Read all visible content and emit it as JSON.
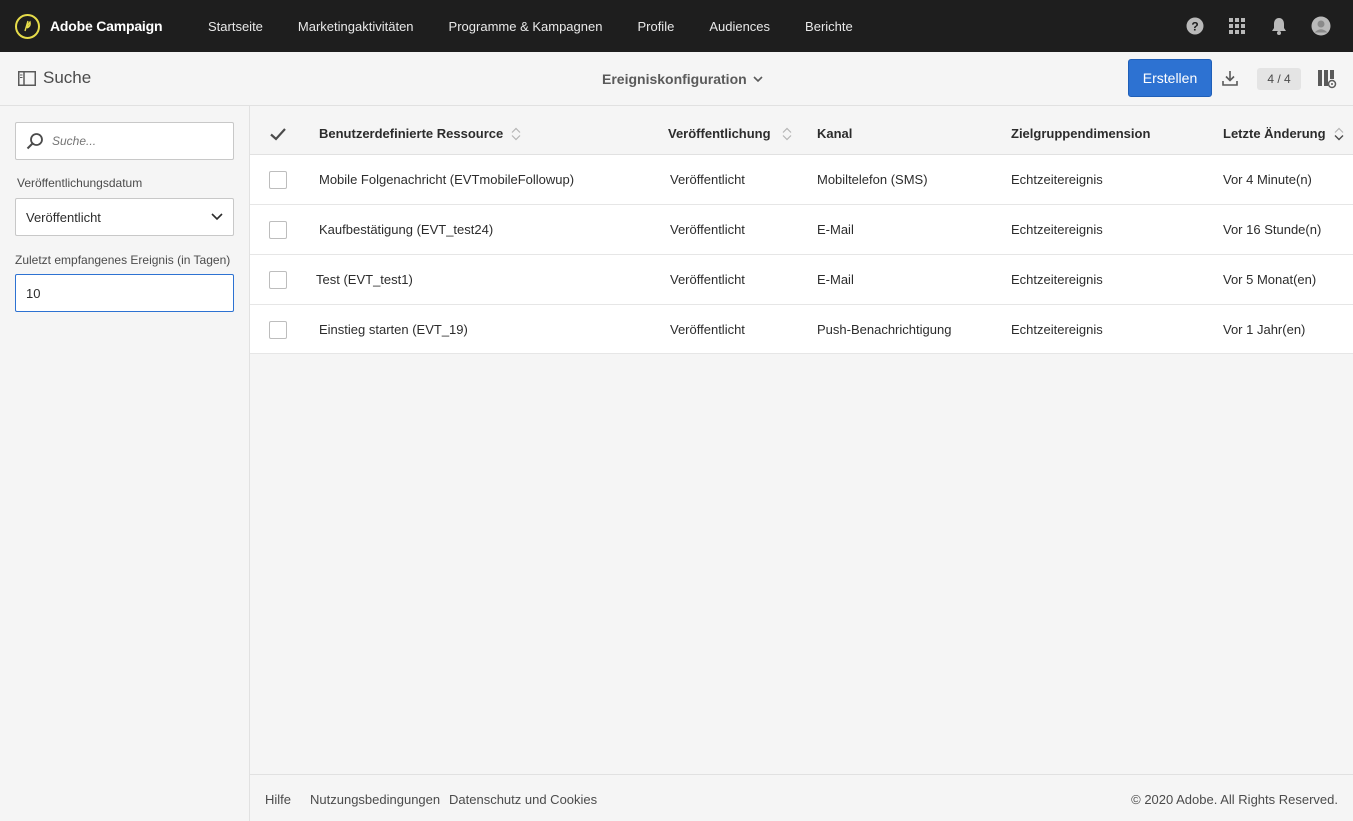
{
  "app": {
    "brand": "Adobe Campaign",
    "nav": [
      "Startseite",
      "Marketingaktivitäten",
      "Programme & Kampagnen",
      "Profile",
      "Audiences",
      "Berichte"
    ],
    "icons": [
      "help-icon",
      "apps-grid-icon",
      "bell-icon",
      "user-avatar-icon"
    ]
  },
  "subheader": {
    "search_title": "Suche",
    "view_title": "Ereigniskonfiguration",
    "create_label": "Erstellen",
    "count": "4 / 4"
  },
  "filters": {
    "search_placeholder": "Suche...",
    "publication_label": "Veröffentlichungsdatum",
    "publication_value": "Veröffentlicht",
    "days_label": "Zuletzt empfangenes Ereignis (in Tagen)",
    "days_value": "10"
  },
  "table": {
    "headers": {
      "resource": "Benutzerdefinierte Ressource",
      "publication": "Veröffentlichung",
      "channel": "Kanal",
      "targeting": "Zielgruppendimension",
      "modified": "Letzte Änderung"
    },
    "rows": [
      {
        "resource": "Mobile Folgenachricht (EVTmobileFollowup)",
        "publication": "Veröffentlicht",
        "channel": "Mobiltelefon (SMS)",
        "targeting": "Echtzeitereignis",
        "modified": "Vor 4 Minute(n)"
      },
      {
        "resource": "Kaufbestätigung (EVT_test24)",
        "publication": "Veröffentlicht",
        "channel": "E-Mail",
        "targeting": "Echtzeitereignis",
        "modified": "Vor 16 Stunde(n)"
      },
      {
        "resource": "Test (EVT_test1)",
        "publication": "Veröffentlicht",
        "channel": "E-Mail",
        "targeting": "Echtzeitereignis",
        "modified": "Vor 5 Monat(en)"
      },
      {
        "resource": "Einstieg starten (EVT_19)",
        "publication": "Veröffentlicht",
        "channel": "Push-Benachrichtigung",
        "targeting": "Echtzeitereignis",
        "modified": "Vor 1 Jahr(en)"
      }
    ]
  },
  "footer": {
    "links": [
      "Hilfe",
      "Nutzungsbedingungen",
      "Datenschutz und Cookies"
    ],
    "copyright": "© 2020 Adobe. All Rights Reserved."
  },
  "colors": {
    "topbar": "#1e1e1e",
    "accent": "#2d72d2",
    "logo_ring": "#e6dc4a"
  }
}
